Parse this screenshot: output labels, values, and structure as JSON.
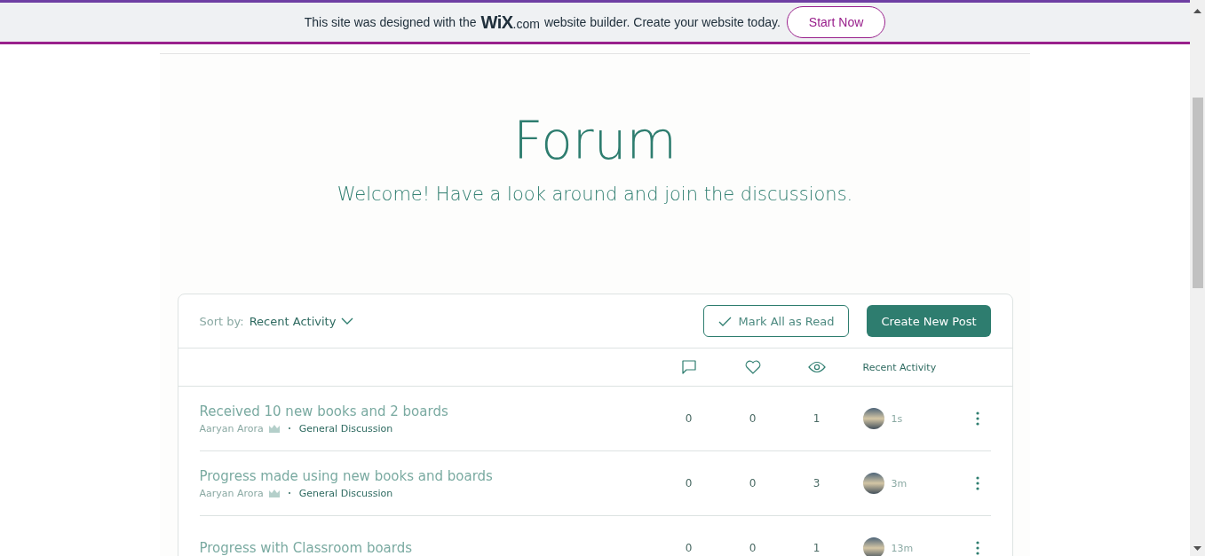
{
  "banner": {
    "text_before": "This site was designed with the",
    "logo_main": "WiX",
    "logo_suffix": ".com",
    "text_after": "website builder. Create your website today.",
    "button": "Start Now"
  },
  "header": {
    "title": "Forum",
    "subtitle": "Welcome! Have a look around and join the discussions."
  },
  "toolbar": {
    "sort_label": "Sort by:",
    "sort_value": "Recent Activity",
    "mark_read": "Mark All as Read",
    "create": "Create New Post"
  },
  "table": {
    "columns": {
      "activity": "Recent Activity"
    },
    "rows": [
      {
        "title": "Received 10 new books and 2 boards",
        "author": "Aaryan Arora",
        "category": "General Discussion",
        "comments": "0",
        "likes": "0",
        "views": "1",
        "time": "1s"
      },
      {
        "title": "Progress made using new books and boards",
        "author": "Aaryan Arora",
        "category": "General Discussion",
        "comments": "0",
        "likes": "0",
        "views": "3",
        "time": "3m"
      },
      {
        "title": "Progress with Classroom boards",
        "comments": "0",
        "likes": "0",
        "views": "1",
        "time": "13m"
      }
    ]
  }
}
